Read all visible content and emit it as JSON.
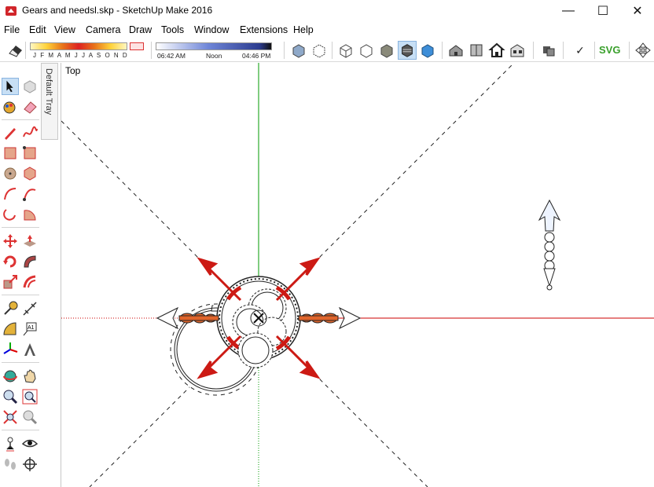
{
  "window": {
    "title": "Gears and needsl.skp - SketchUp Make 2016",
    "minimize": "—",
    "maximize": "☐",
    "close": "✕"
  },
  "menu": [
    "File",
    "Edit",
    "View",
    "Camera",
    "Draw",
    "Tools",
    "Window",
    "Extensions",
    "Help"
  ],
  "shadow": {
    "months": "J F M A M J J A S O N D",
    "time_start": "06:42 AM",
    "time_mid": "Noon",
    "time_end": "04:46 PM"
  },
  "toolbar": {
    "svg_label": "SVG",
    "check_label": "✓"
  },
  "tray": {
    "label": "Default Tray"
  },
  "viewport": {
    "view_name": "Top"
  },
  "colors": {
    "axis_red": "#cc0000",
    "axis_green": "#009900",
    "needle_red": "#cc1a14",
    "selection": "#c7dff5"
  }
}
